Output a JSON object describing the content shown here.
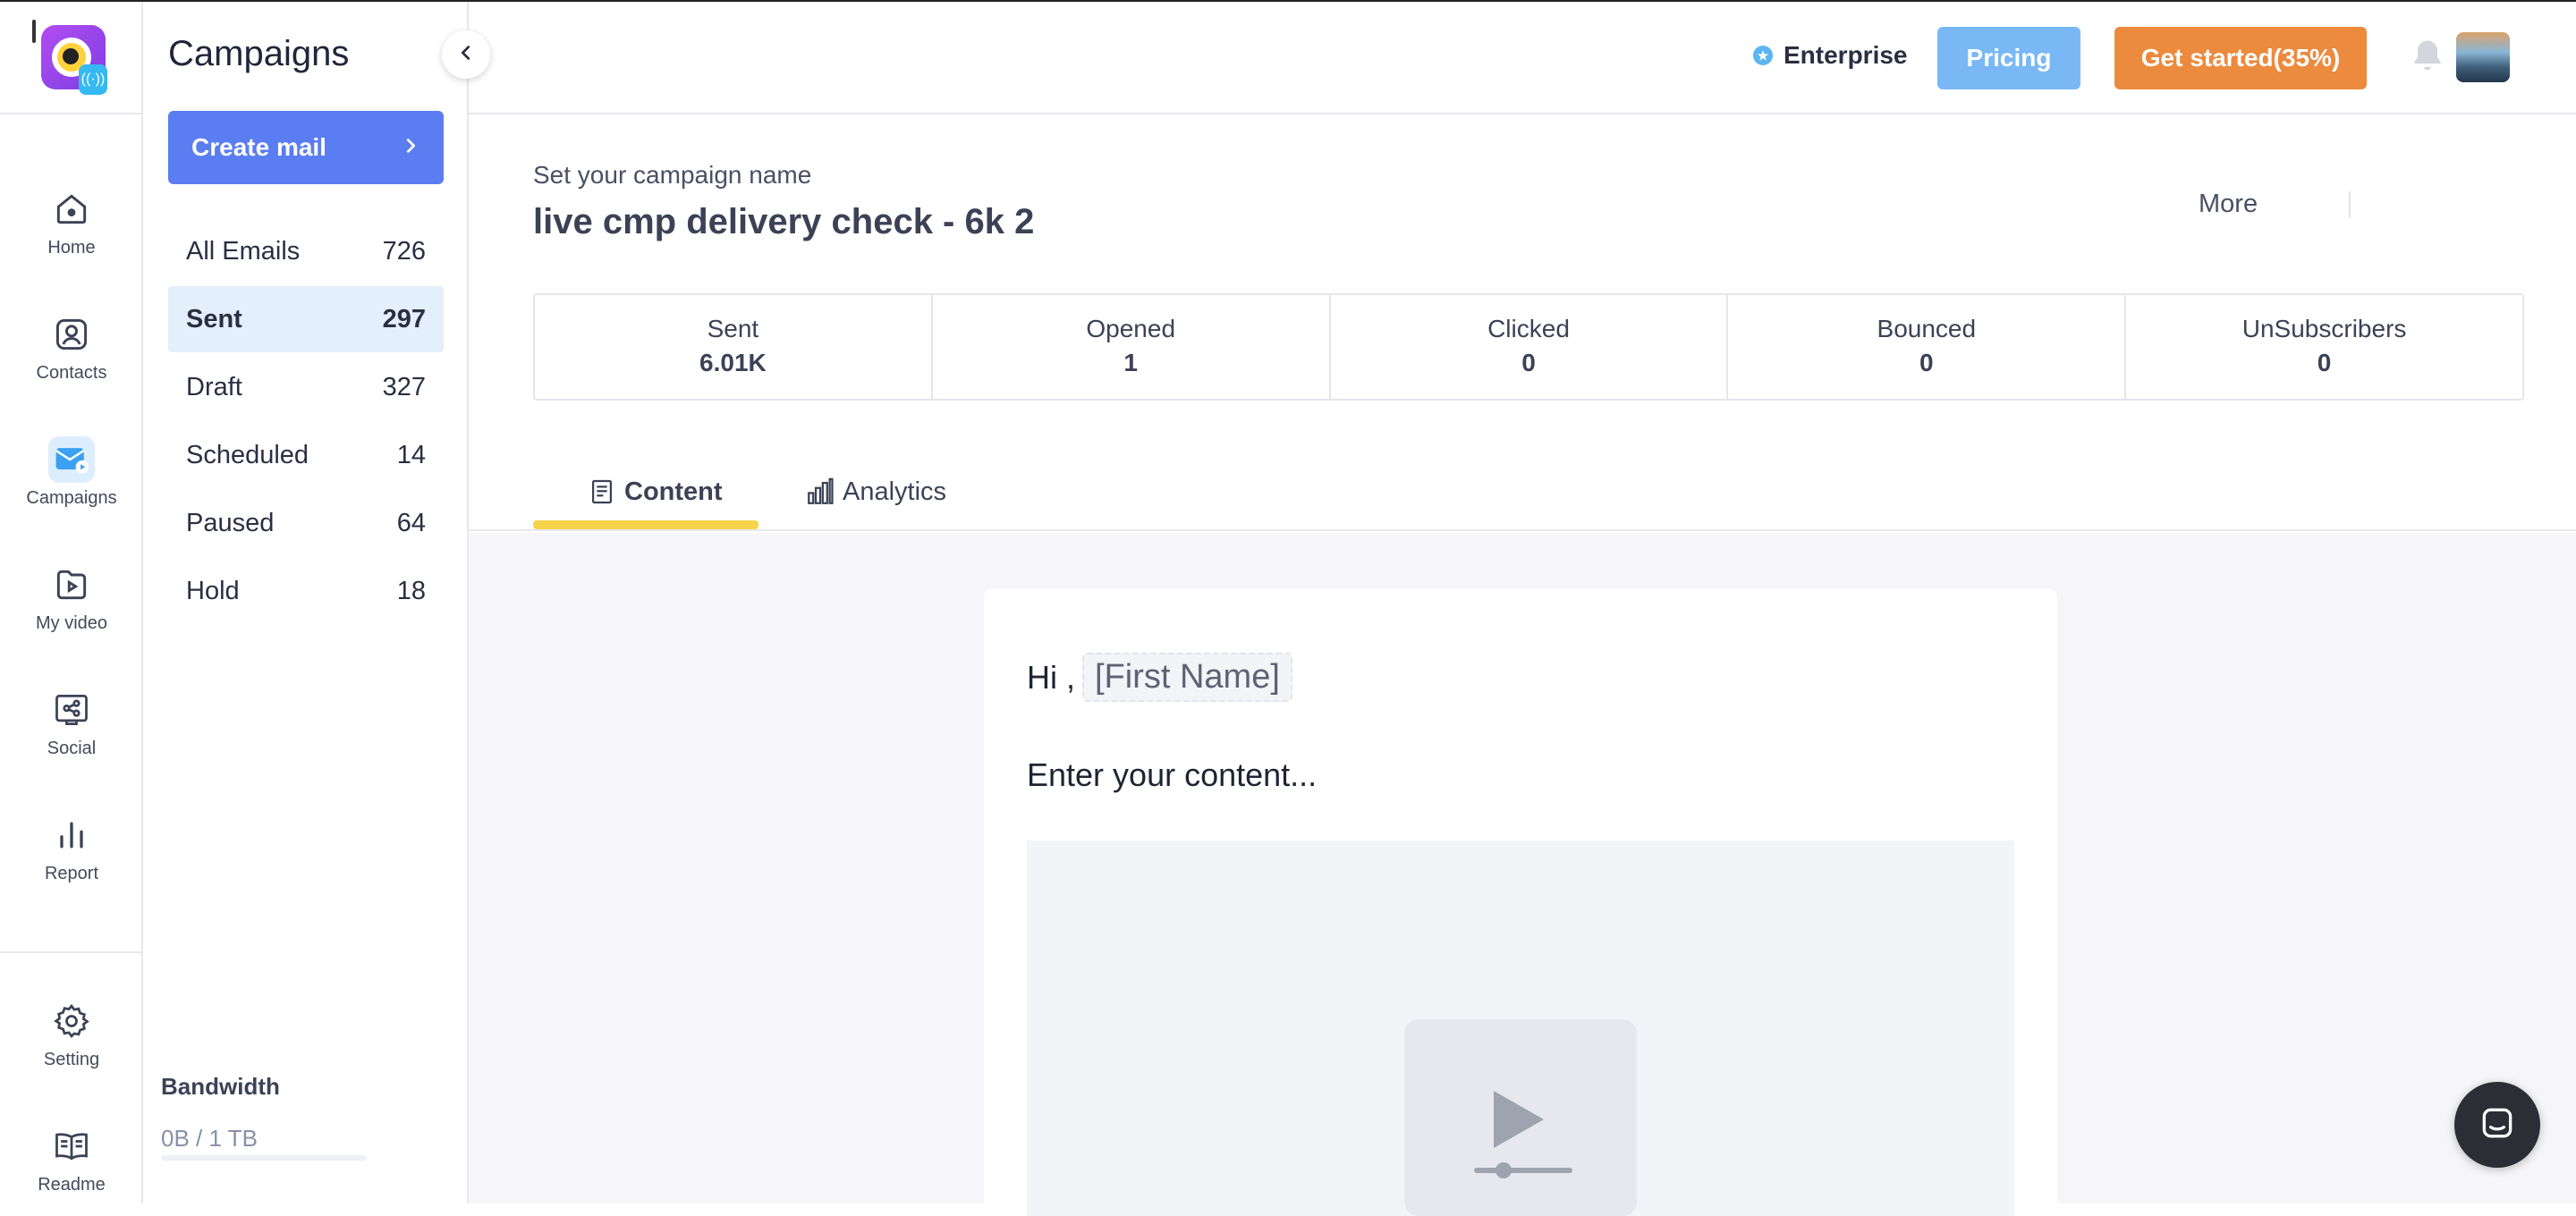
{
  "rail": {
    "items": [
      {
        "label": "Home",
        "icon": "home-icon"
      },
      {
        "label": "Contacts",
        "icon": "contacts-icon"
      },
      {
        "label": "Campaigns",
        "icon": "mail-video-icon"
      },
      {
        "label": "My video",
        "icon": "video-icon"
      },
      {
        "label": "Social",
        "icon": "share-icon"
      },
      {
        "label": "Report",
        "icon": "bar-chart-icon"
      },
      {
        "label": "Setting",
        "icon": "gear-icon"
      },
      {
        "label": "Readme",
        "icon": "book-icon"
      }
    ]
  },
  "sidebar": {
    "title": "Campaigns",
    "create_label": "Create mail",
    "folders": [
      {
        "label": "All Emails",
        "count": "726"
      },
      {
        "label": "Sent",
        "count": "297"
      },
      {
        "label": "Draft",
        "count": "327"
      },
      {
        "label": "Scheduled",
        "count": "14"
      },
      {
        "label": "Paused",
        "count": "64"
      },
      {
        "label": "Hold",
        "count": "18"
      }
    ],
    "bandwidth_label": "Bandwidth",
    "bandwidth_value": "0B / 1 TB",
    "bandwidth_used_fraction": 0
  },
  "header": {
    "plan": "Enterprise",
    "pricing_label": "Pricing",
    "get_started_label": "Get started(35%)"
  },
  "campaign": {
    "subtitle": "Set your campaign name",
    "name": "live cmp delivery check - 6k 2",
    "more_label": "More",
    "stats": [
      {
        "label": "Sent",
        "value": "6.01K"
      },
      {
        "label": "Opened",
        "value": "1"
      },
      {
        "label": "Clicked",
        "value": "0"
      },
      {
        "label": "Bounced",
        "value": "0"
      },
      {
        "label": "UnSubscribers",
        "value": "0"
      }
    ],
    "tabs": [
      {
        "label": "Content"
      },
      {
        "label": "Analytics"
      }
    ]
  },
  "email": {
    "greeting": "Hi ,",
    "merge_tag": "[First Name]",
    "body": "Enter your content..."
  },
  "colors": {
    "accent": "#5a7df2",
    "pricing": "#7ab8f5",
    "get_started": "#ec8a3d",
    "tab_underline": "#f5d44a"
  }
}
